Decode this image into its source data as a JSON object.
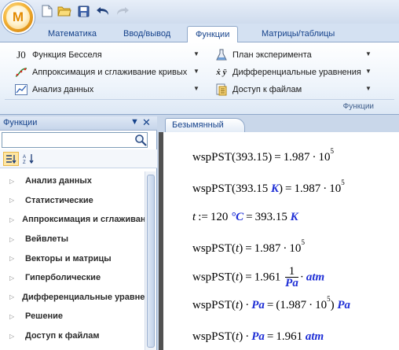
{
  "app": {
    "logo_letter": "M"
  },
  "tabs": [
    "Математика",
    "Ввод/вывод",
    "Функции",
    "Матрицы/таблицы"
  ],
  "active_tab": "Функции",
  "ribbon": {
    "left_items": [
      {
        "label": "Функция Бесселя",
        "icon": "bessel-J0-icon",
        "icon_text": "J0"
      },
      {
        "label": "Аппроксимация и сглаживание кривых",
        "icon": "curve-fit-icon"
      },
      {
        "label": "Анализ данных",
        "icon": "chart-icon"
      }
    ],
    "right_items": [
      {
        "label": "План эксперимента",
        "icon": "flask-icon"
      },
      {
        "label": "Дифференциальные уравнения",
        "icon": "xdot-icon",
        "icon_text": "ẋ ÿ"
      },
      {
        "label": "Доступ к файлам",
        "icon": "file-access-icon"
      }
    ],
    "group_label": "Функции"
  },
  "panel": {
    "title": "Функции",
    "search_placeholder": "",
    "items": [
      "Анализ данных",
      "Статистические",
      "Аппроксимация и сглаживание кривых",
      "Вейвлеты",
      "Векторы и матрицы",
      "Гиперболические",
      "Дифференциальные уравнения",
      "Решение",
      "Доступ к файлам"
    ]
  },
  "document": {
    "tab_label": "Безымянный",
    "lines": [
      {
        "lhs": "wspPST",
        "arg": "393.15",
        "arg_unit": "",
        "result": "1.987",
        "exp": "5",
        "result_unit": ""
      },
      {
        "lhs": "wspPST",
        "arg": "393.15",
        "arg_unit": "K",
        "result": "1.987",
        "exp": "5",
        "result_unit": ""
      },
      {
        "assign_var": "t",
        "assign_op": ":=",
        "assign_val": "120",
        "assign_unit": "°C",
        "eq_val": "393.15",
        "eq_unit": "K"
      },
      {
        "lhs": "wspPST",
        "arg": "t",
        "result": "1.987",
        "exp": "5"
      },
      {
        "lhs": "wspPST",
        "arg": "t",
        "result": "1.961",
        "frac_num": "1",
        "frac_den": "Pa",
        "result_unit": "atm"
      },
      {
        "lhs": "wspPST",
        "arg": "t",
        "times_unit": "Pa",
        "result": "1.987",
        "exp": "5",
        "result_unit": "Pa"
      },
      {
        "lhs": "wspPST",
        "arg": "t",
        "times_unit": "Pa",
        "result": "1.961",
        "result_unit": "atm"
      }
    ]
  },
  "colors": {
    "accent": "#15428b",
    "unit_blue": "#1f2fd6",
    "ribbon_bg": "#dde8f5"
  }
}
